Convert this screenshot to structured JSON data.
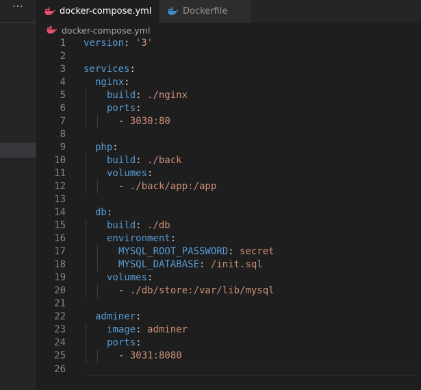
{
  "sidebar": {
    "more_label": "···"
  },
  "tabs": [
    {
      "label": "docker-compose.yml",
      "icon": "docker-compose-icon",
      "active": true
    },
    {
      "label": "Dockerfile",
      "icon": "docker-icon",
      "active": false
    }
  ],
  "breadcrumb": {
    "file": "docker-compose.yml",
    "icon": "docker-compose-icon"
  },
  "colors": {
    "key": "#569cd6",
    "string": "#ce9178",
    "line_number": "#858585",
    "compose_icon": "#e84f6f",
    "docker_icon": "#3b8ecf"
  },
  "editor": {
    "lines": [
      {
        "n": "1",
        "indent": 0,
        "parts": [
          {
            "t": "version",
            "c": "k"
          },
          {
            "t": ": ",
            "c": "p"
          },
          {
            "t": "'3'",
            "c": "s"
          }
        ]
      },
      {
        "n": "2",
        "indent": 0,
        "parts": []
      },
      {
        "n": "3",
        "indent": 0,
        "parts": [
          {
            "t": "services",
            "c": "k"
          },
          {
            "t": ":",
            "c": "p"
          }
        ]
      },
      {
        "n": "4",
        "indent": 1,
        "parts": [
          {
            "t": "nginx",
            "c": "k"
          },
          {
            "t": ":",
            "c": "p"
          }
        ]
      },
      {
        "n": "5",
        "indent": 2,
        "parts": [
          {
            "t": "build",
            "c": "k"
          },
          {
            "t": ": ",
            "c": "p"
          },
          {
            "t": "./nginx",
            "c": "s"
          }
        ]
      },
      {
        "n": "6",
        "indent": 2,
        "parts": [
          {
            "t": "ports",
            "c": "k"
          },
          {
            "t": ":",
            "c": "p"
          }
        ]
      },
      {
        "n": "7",
        "indent": 3,
        "parts": [
          {
            "t": "- ",
            "c": "p"
          },
          {
            "t": "3030:80",
            "c": "s"
          }
        ]
      },
      {
        "n": "8",
        "indent": 0,
        "parts": []
      },
      {
        "n": "9",
        "indent": 1,
        "parts": [
          {
            "t": "php",
            "c": "k"
          },
          {
            "t": ":",
            "c": "p"
          }
        ]
      },
      {
        "n": "10",
        "indent": 2,
        "parts": [
          {
            "t": "build",
            "c": "k"
          },
          {
            "t": ": ",
            "c": "p"
          },
          {
            "t": "./back",
            "c": "s"
          }
        ]
      },
      {
        "n": "11",
        "indent": 2,
        "parts": [
          {
            "t": "volumes",
            "c": "k"
          },
          {
            "t": ":",
            "c": "p"
          }
        ]
      },
      {
        "n": "12",
        "indent": 3,
        "parts": [
          {
            "t": "- ",
            "c": "p"
          },
          {
            "t": "./back/app:/app",
            "c": "s"
          }
        ]
      },
      {
        "n": "13",
        "indent": 0,
        "parts": []
      },
      {
        "n": "14",
        "indent": 1,
        "parts": [
          {
            "t": "db",
            "c": "k"
          },
          {
            "t": ":",
            "c": "p"
          }
        ]
      },
      {
        "n": "15",
        "indent": 2,
        "parts": [
          {
            "t": "build",
            "c": "k"
          },
          {
            "t": ": ",
            "c": "p"
          },
          {
            "t": "./db",
            "c": "s"
          }
        ]
      },
      {
        "n": "16",
        "indent": 2,
        "parts": [
          {
            "t": "environment",
            "c": "k"
          },
          {
            "t": ":",
            "c": "p"
          }
        ]
      },
      {
        "n": "17",
        "indent": 3,
        "parts": [
          {
            "t": "MYSQL_ROOT_PASSWORD",
            "c": "k"
          },
          {
            "t": ": ",
            "c": "p"
          },
          {
            "t": "secret",
            "c": "s"
          }
        ]
      },
      {
        "n": "18",
        "indent": 3,
        "parts": [
          {
            "t": "MYSQL_DATABASE",
            "c": "k"
          },
          {
            "t": ": ",
            "c": "p"
          },
          {
            "t": "/init.sql",
            "c": "s"
          }
        ]
      },
      {
        "n": "19",
        "indent": 2,
        "parts": [
          {
            "t": "volumes",
            "c": "k"
          },
          {
            "t": ":",
            "c": "p"
          }
        ]
      },
      {
        "n": "20",
        "indent": 3,
        "parts": [
          {
            "t": "- ",
            "c": "p"
          },
          {
            "t": "./db/store:/var/lib/mysql",
            "c": "s"
          }
        ]
      },
      {
        "n": "21",
        "indent": 0,
        "parts": []
      },
      {
        "n": "22",
        "indent": 1,
        "parts": [
          {
            "t": "adminer",
            "c": "k"
          },
          {
            "t": ":",
            "c": "p"
          }
        ]
      },
      {
        "n": "23",
        "indent": 2,
        "parts": [
          {
            "t": "image",
            "c": "k"
          },
          {
            "t": ": ",
            "c": "p"
          },
          {
            "t": "adminer",
            "c": "s"
          }
        ]
      },
      {
        "n": "24",
        "indent": 2,
        "parts": [
          {
            "t": "ports",
            "c": "k"
          },
          {
            "t": ":",
            "c": "p"
          }
        ]
      },
      {
        "n": "25",
        "indent": 3,
        "parts": [
          {
            "t": "- ",
            "c": "p"
          },
          {
            "t": "3031:8080",
            "c": "s"
          }
        ]
      },
      {
        "n": "26",
        "indent": 0,
        "parts": [],
        "current": true
      }
    ]
  }
}
